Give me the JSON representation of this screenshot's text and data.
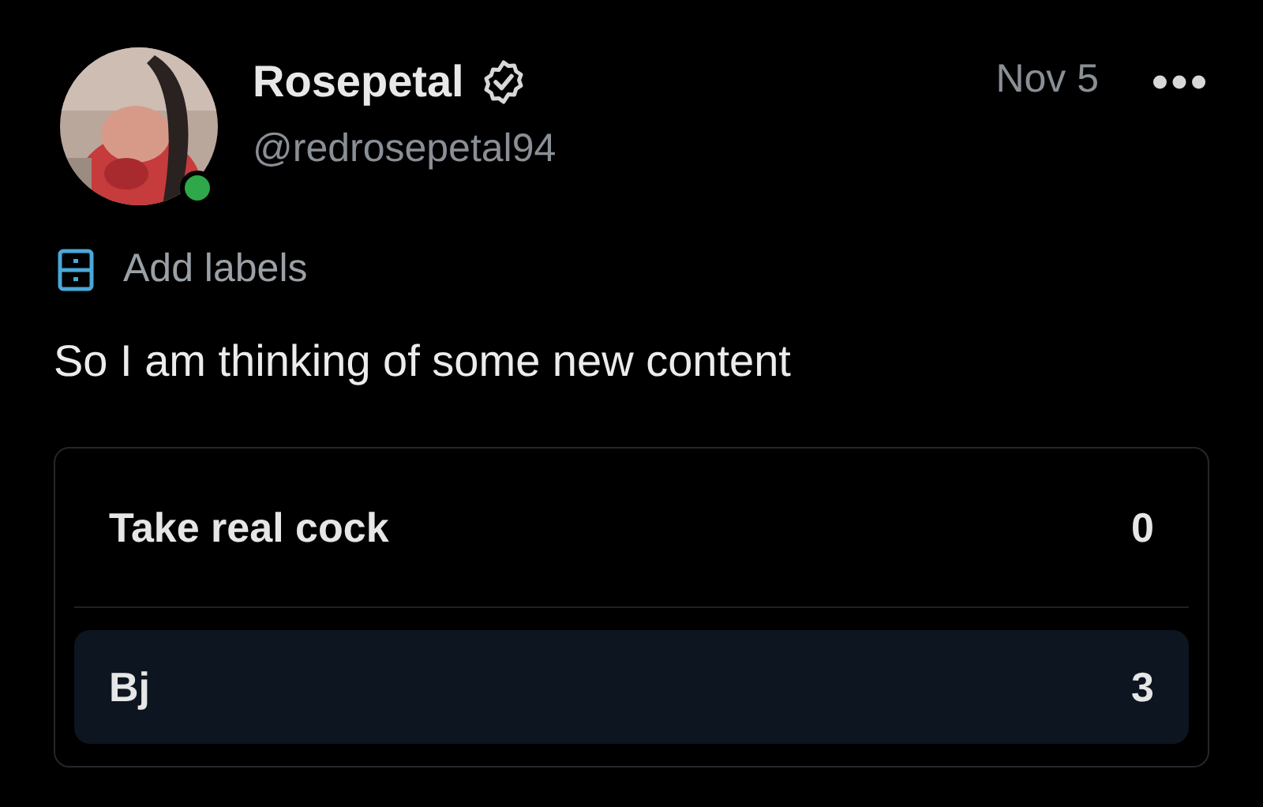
{
  "post": {
    "author": {
      "name": "Rosepetal",
      "verified": true,
      "online": true,
      "handle": "@redrosepetal94"
    },
    "date": "Nov 5",
    "labels_action": "Add labels",
    "text": "So I am thinking of some new content"
  },
  "poll": {
    "options": [
      {
        "label": "Take real cock",
        "count": "0",
        "selected": false
      },
      {
        "label": "Bj",
        "count": "3",
        "selected": true
      }
    ]
  }
}
